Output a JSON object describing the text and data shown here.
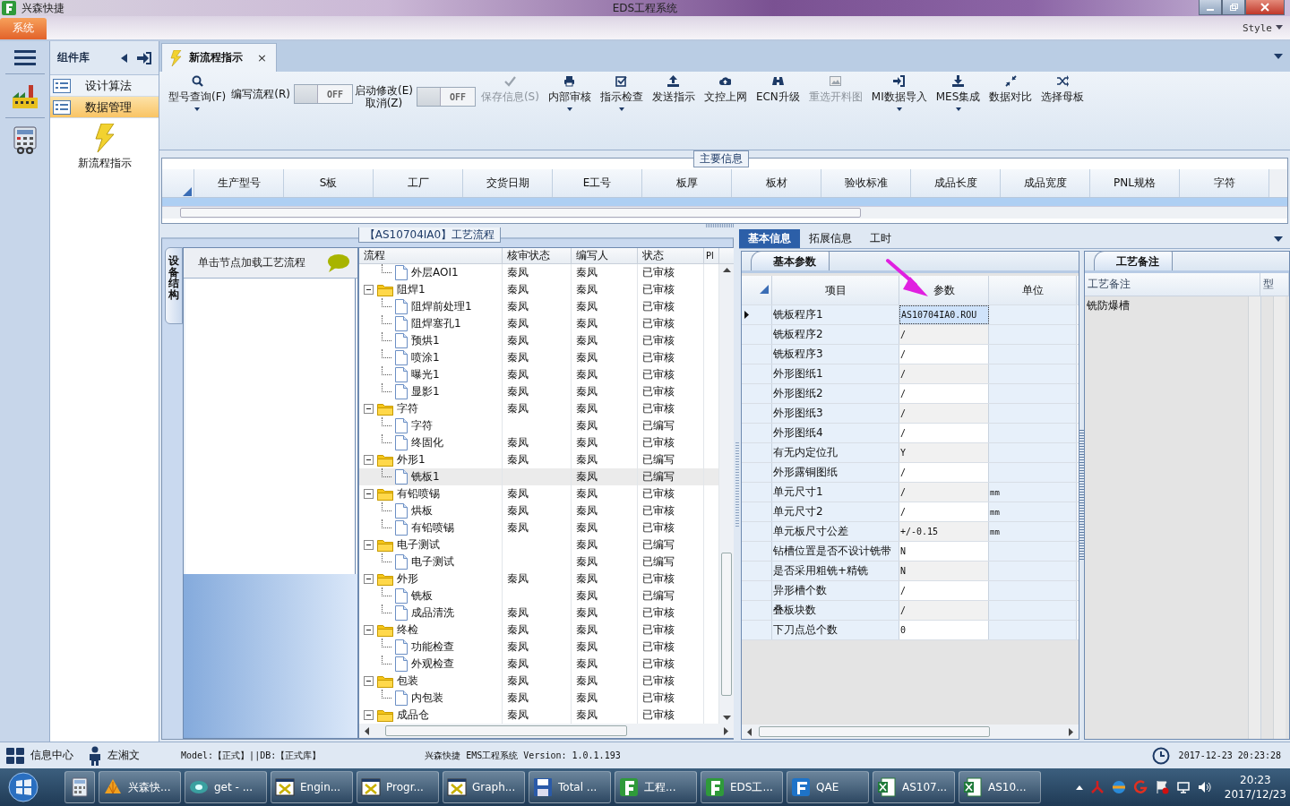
{
  "title_bar": {
    "app_name": "兴森快捷",
    "title": "EDS工程系统"
  },
  "menu_bar": {
    "tabs": [
      {
        "label": "系统",
        "selected": true
      }
    ],
    "style_label": "Style"
  },
  "component_panel": {
    "title": "组件库",
    "items": [
      {
        "label": "设计算法",
        "selected": false
      },
      {
        "label": "数据管理",
        "selected": true
      }
    ],
    "launchers": [
      {
        "label": "新流程指示"
      }
    ]
  },
  "doc_tabs": [
    {
      "label": "新流程指示",
      "selected": true,
      "close": "×"
    }
  ],
  "ribbon": {
    "buttons": [
      {
        "kind": "button",
        "lines": [
          "型号查询(F)"
        ],
        "dropdown": true,
        "disabled": false
      },
      {
        "kind": "toggle",
        "lines": [
          "编写流程(R)"
        ],
        "on": false,
        "state_text": "OFF"
      },
      {
        "kind": "toggle",
        "lines": [
          "启动修改(E)",
          "取消(Z)"
        ],
        "on": false,
        "state_text": "OFF"
      },
      {
        "kind": "button",
        "lines": [
          "保存信息(S)"
        ],
        "dropdown": false,
        "disabled": true
      },
      {
        "kind": "button",
        "lines": [
          "内部审核"
        ],
        "dropdown": true,
        "disabled": false
      },
      {
        "kind": "button",
        "lines": [
          "指示检查"
        ],
        "dropdown": true,
        "disabled": false
      },
      {
        "kind": "button",
        "lines": [
          "发送指示"
        ],
        "dropdown": false,
        "disabled": false
      },
      {
        "kind": "button",
        "lines": [
          "文控上网"
        ],
        "dropdown": false,
        "disabled": false
      },
      {
        "kind": "button",
        "lines": [
          "ECN升级"
        ],
        "dropdown": false,
        "disabled": false
      },
      {
        "kind": "button",
        "lines": [
          "重选开料图"
        ],
        "dropdown": false,
        "disabled": true
      },
      {
        "kind": "button",
        "lines": [
          "MI数据导入"
        ],
        "dropdown": true,
        "disabled": false
      },
      {
        "kind": "button",
        "lines": [
          "MES集成"
        ],
        "dropdown": true,
        "disabled": false
      },
      {
        "kind": "button",
        "lines": [
          "数据对比"
        ],
        "dropdown": false,
        "disabled": false
      },
      {
        "kind": "button",
        "lines": [
          "选择母板"
        ],
        "dropdown": false,
        "disabled": false
      }
    ]
  },
  "main_info": {
    "title": "主要信息",
    "columns": [
      "生产型号",
      "S板",
      "工厂",
      "交货日期",
      "E工号",
      "板厚",
      "板材",
      "验收标准",
      "成品长度",
      "成品宽度",
      "PNL规格",
      "字符"
    ]
  },
  "process_panel": {
    "title": "【AS10704IA0】工艺流程",
    "side_tab": "设备结构",
    "hint": "单击节点加载工艺流程",
    "columns": [
      "流程",
      "核审状态",
      "编写人",
      "状态",
      "Pl"
    ],
    "nodes": [
      {
        "children": [
          {
            "kind": "file",
            "label": "外层AOI1",
            "review": "秦凤",
            "author": "秦凤",
            "status": "已审核",
            "selected": false
          }
        ]
      },
      {
        "kind": "folder",
        "label": "阻焊1",
        "review": "秦凤",
        "author": "秦凤",
        "status": "已审核",
        "selected": false,
        "expanded": true,
        "children": [
          {
            "kind": "file",
            "label": "阻焊前处理1",
            "review": "秦凤",
            "author": "秦凤",
            "status": "已审核",
            "selected": false
          },
          {
            "kind": "file",
            "label": "阻焊塞孔1",
            "review": "秦凤",
            "author": "秦凤",
            "status": "已审核",
            "selected": false
          },
          {
            "kind": "file",
            "label": "预烘1",
            "review": "秦凤",
            "author": "秦凤",
            "status": "已审核",
            "selected": false
          },
          {
            "kind": "file",
            "label": "喷涂1",
            "review": "秦凤",
            "author": "秦凤",
            "status": "已审核",
            "selected": false
          },
          {
            "kind": "file",
            "label": "曝光1",
            "review": "秦凤",
            "author": "秦凤",
            "status": "已审核",
            "selected": false
          },
          {
            "kind": "file",
            "label": "显影1",
            "review": "秦凤",
            "author": "秦凤",
            "status": "已审核",
            "selected": false
          }
        ]
      },
      {
        "kind": "folder",
        "label": "字符",
        "review": "秦凤",
        "author": "秦凤",
        "status": "已审核",
        "selected": false,
        "expanded": true,
        "children": [
          {
            "kind": "file",
            "label": "字符",
            "author": "秦凤",
            "status": "已编写",
            "selected": false
          },
          {
            "kind": "file",
            "label": "终固化",
            "review": "秦凤",
            "author": "秦凤",
            "status": "已审核",
            "selected": false
          }
        ]
      },
      {
        "kind": "folder",
        "label": "外形1",
        "review": "秦凤",
        "author": "秦凤",
        "status": "已编写",
        "selected": false,
        "expanded": true,
        "children": [
          {
            "kind": "file",
            "label": "铣板1",
            "author": "秦凤",
            "status": "已编写",
            "selected": true
          }
        ]
      },
      {
        "kind": "folder",
        "label": "有铅喷锡",
        "review": "秦凤",
        "author": "秦凤",
        "status": "已审核",
        "selected": false,
        "expanded": true,
        "children": [
          {
            "kind": "file",
            "label": "烘板",
            "review": "秦凤",
            "author": "秦凤",
            "status": "已审核",
            "selected": false
          },
          {
            "kind": "file",
            "label": "有铅喷锡",
            "review": "秦凤",
            "author": "秦凤",
            "status": "已审核",
            "selected": false
          }
        ]
      },
      {
        "kind": "folder",
        "label": "电子测试",
        "author": "秦凤",
        "status": "已编写",
        "selected": false,
        "expanded": true,
        "children": [
          {
            "kind": "file",
            "label": "电子测试",
            "author": "秦凤",
            "status": "已编写",
            "selected": false
          }
        ]
      },
      {
        "kind": "folder",
        "label": "外形",
        "review": "秦凤",
        "author": "秦凤",
        "status": "已审核",
        "selected": false,
        "expanded": true,
        "children": [
          {
            "kind": "file",
            "label": "铣板",
            "author": "秦凤",
            "status": "已编写",
            "selected": false
          },
          {
            "kind": "file",
            "label": "成品清洗",
            "review": "秦凤",
            "author": "秦凤",
            "status": "已审核",
            "selected": false
          }
        ]
      },
      {
        "kind": "folder",
        "label": "终检",
        "review": "秦凤",
        "author": "秦凤",
        "status": "已审核",
        "selected": false,
        "expanded": true,
        "children": [
          {
            "kind": "file",
            "label": "功能检查",
            "review": "秦凤",
            "author": "秦凤",
            "status": "已审核",
            "selected": false
          },
          {
            "kind": "file",
            "label": "外观检查",
            "review": "秦凤",
            "author": "秦凤",
            "status": "已审核",
            "selected": false
          }
        ]
      },
      {
        "kind": "folder",
        "label": "包装",
        "review": "秦凤",
        "author": "秦凤",
        "status": "已审核",
        "selected": false,
        "expanded": true,
        "children": [
          {
            "kind": "file",
            "label": "内包装",
            "review": "秦凤",
            "author": "秦凤",
            "status": "已审核",
            "selected": false
          }
        ]
      },
      {
        "kind": "folder",
        "label": "成品仓",
        "review": "秦凤",
        "author": "秦凤",
        "status": "已审核",
        "selected": false,
        "expanded": true
      }
    ]
  },
  "detail_tabs": [
    {
      "label": "基本信息",
      "selected": true
    },
    {
      "label": "拓展信息",
      "selected": false
    },
    {
      "label": "工时",
      "selected": false
    }
  ],
  "params": {
    "title": "基本参数",
    "columns": [
      "项目",
      "参数",
      "单位"
    ],
    "rows": [
      {
        "item": "铣板程序1",
        "value": "AS10704IA0.ROU",
        "current": true
      },
      {
        "item": "铣板程序2",
        "value": "/",
        "current": false
      },
      {
        "item": "铣板程序3",
        "value": "/",
        "current": false
      },
      {
        "item": "外形图纸1",
        "value": "/",
        "current": false
      },
      {
        "item": "外形图纸2",
        "value": "/",
        "current": false
      },
      {
        "item": "外形图纸3",
        "value": "/",
        "current": false
      },
      {
        "item": "外形图纸4",
        "value": "/",
        "current": false
      },
      {
        "item": "有无内定位孔",
        "value": "Y",
        "current": false
      },
      {
        "item": "外形露铜图纸",
        "value": "/",
        "current": false
      },
      {
        "item": "单元尺寸1",
        "value": "/",
        "unit": "mm",
        "current": false
      },
      {
        "item": "单元尺寸2",
        "value": "/",
        "unit": "mm",
        "current": false
      },
      {
        "item": "单元板尺寸公差",
        "value": "+/-0.15",
        "unit": "mm",
        "current": false
      },
      {
        "item": "钻槽位置是否不设计铣带",
        "value": "N",
        "current": false
      },
      {
        "item": "是否采用粗铣+精铣",
        "value": "N",
        "current": false
      },
      {
        "item": "异形槽个数",
        "value": "/",
        "current": false
      },
      {
        "item": "叠板块数",
        "value": "/",
        "current": false
      },
      {
        "item": "下刀点总个数",
        "value": "0",
        "current": false
      }
    ]
  },
  "notes": {
    "title": "工艺备注",
    "columns": [
      "工艺备注",
      "型"
    ],
    "rows": [
      "铣防爆槽"
    ]
  },
  "status_bar": {
    "info_center": "信息中心",
    "user": "左湘文",
    "environment": "Model:【正式】||DB:【正式库】",
    "version": "兴森快捷 EMS工程系统 Version: 1.0.1.193",
    "datetime": "2017-12-23 20:23:28"
  },
  "taskbar": {
    "items": [
      {
        "kind": "icon"
      },
      {
        "kind": "app",
        "label": "兴森快..."
      },
      {
        "kind": "app",
        "label": "get - ..."
      },
      {
        "kind": "app",
        "label": "Engin..."
      },
      {
        "kind": "app",
        "label": "Progr..."
      },
      {
        "kind": "app",
        "label": "Graph..."
      },
      {
        "kind": "app",
        "label": "Total ..."
      },
      {
        "kind": "app",
        "label": "工程..."
      },
      {
        "kind": "app",
        "label": "EDS工..."
      },
      {
        "kind": "app",
        "label": "QAE"
      },
      {
        "kind": "app",
        "label": "AS107..."
      },
      {
        "kind": "app",
        "label": "AS10..."
      }
    ],
    "time": "20:23",
    "date": "2017/12/23"
  }
}
